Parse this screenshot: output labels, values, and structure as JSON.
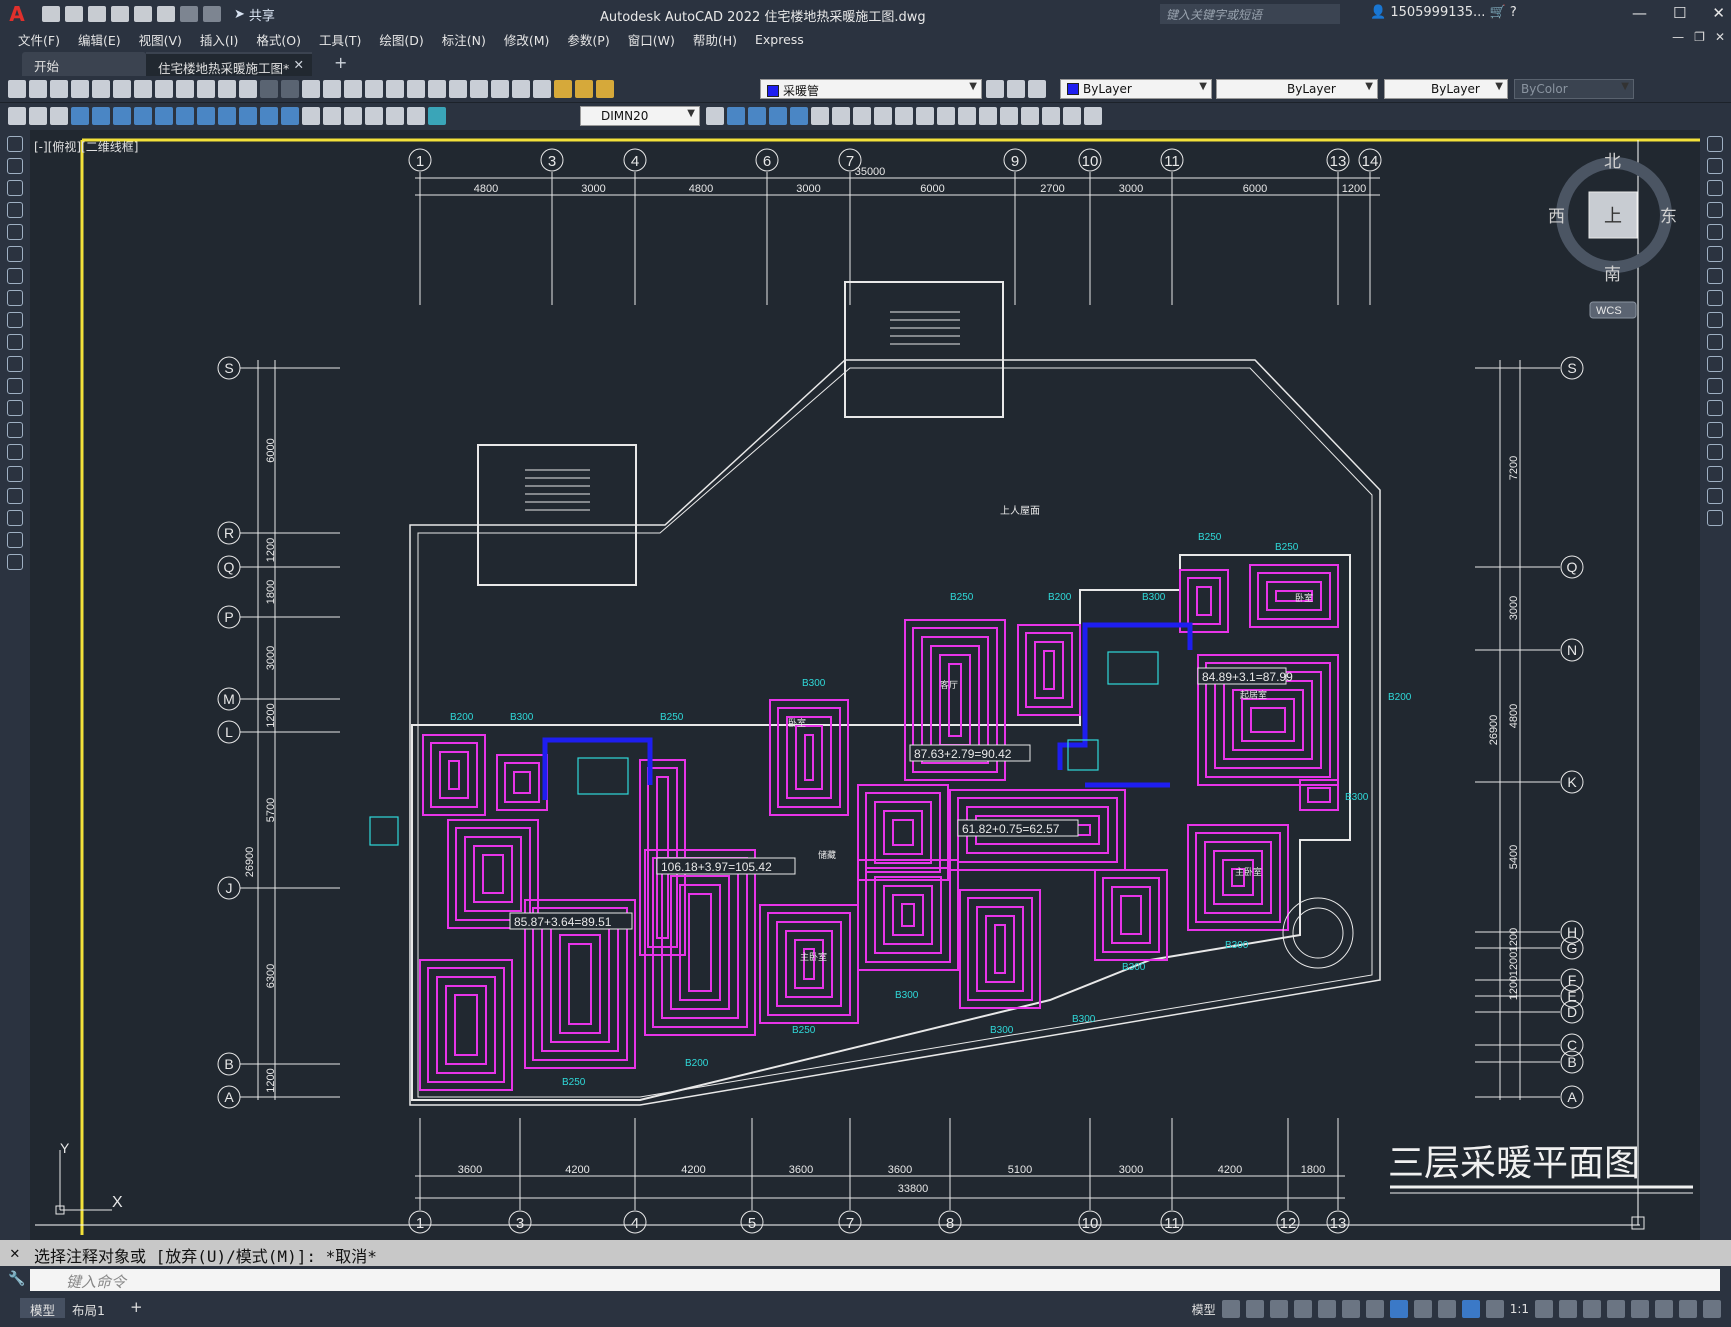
{
  "titlebar": {
    "app_title": "Autodesk AutoCAD 2022    住宅楼地热采暖施工图.dwg",
    "share_label": "共享",
    "search_placeholder": "键入关键字或短语",
    "user": "1505999135...",
    "logo": "A",
    "window_controls": [
      "—",
      "☐",
      "✕"
    ]
  },
  "menubar": {
    "items": [
      "文件(F)",
      "编辑(E)",
      "视图(V)",
      "插入(I)",
      "格式(O)",
      "工具(T)",
      "绘图(D)",
      "标注(N)",
      "修改(M)",
      "参数(P)",
      "窗口(W)",
      "帮助(H)",
      "Express"
    ]
  },
  "tabs": {
    "start": "开始",
    "drawing": "住宅楼地热采暖施工图*",
    "close": "✕",
    "add": "+"
  },
  "toolbar": {
    "layer": "采暖管",
    "layer_color": "#1e1ef0",
    "color": "ByLayer",
    "linetype": "ByLayer",
    "lineweight": "ByLayer",
    "plotstyle": "ByColor",
    "dimstyle": "DIMN20"
  },
  "viewport": {
    "label": "[-][俯视][二维线框]",
    "viewcube": {
      "north": "北",
      "south": "南",
      "east": "东",
      "west": "西",
      "top": "上",
      "wcs": "WCS"
    },
    "ucs": {
      "x": "X",
      "y": "Y"
    }
  },
  "drawing": {
    "title": "三层采暖平面图",
    "roof_label": "上人屋面",
    "top_axes": [
      "1",
      "3",
      "4",
      "6",
      "7",
      "9",
      "10",
      "11",
      "13",
      "14"
    ],
    "top_dims": [
      "4800",
      "3000",
      "4800",
      "3000",
      "6000",
      "2700",
      "3000",
      "6000",
      "1200"
    ],
    "top_total": "35000",
    "bottom_axes": [
      "1",
      "3",
      "4",
      "5",
      "7",
      "8",
      "10",
      "11",
      "12",
      "13"
    ],
    "bottom_dims": [
      "3600",
      "4200",
      "4200",
      "3600",
      "3600",
      "5100",
      "3000",
      "4200",
      "1800"
    ],
    "bottom_total": "33800",
    "left_axes": [
      "S",
      "R",
      "Q",
      "P",
      "M",
      "L",
      "J",
      "B",
      "A"
    ],
    "left_dims": [
      "6000",
      "1200",
      "1800",
      "3000",
      "1200",
      "5700",
      "6300",
      "1200"
    ],
    "left_total": "26900",
    "right_axes": [
      "S",
      "Q",
      "N",
      "K",
      "H",
      "G",
      "F",
      "E",
      "D",
      "C",
      "B",
      "A"
    ],
    "right_dims": [
      "7200",
      "3000",
      "4800",
      "5400",
      "1200",
      "1200",
      "1200"
    ],
    "right_total": "26900",
    "loop_tags": [
      "B200",
      "B300",
      "B250",
      "B300",
      "B250",
      "B200",
      "B300",
      "B250",
      "B250",
      "B300",
      "B300",
      "B300",
      "B300",
      "B300",
      "B250",
      "B200",
      "B250",
      "B200",
      "B300"
    ],
    "area_labels": [
      "84.89+3.1=87.99",
      "87.63+2.79=90.42",
      "106.18+3.97=105.42",
      "61.82+0.75=62.57",
      "85.87+3.64=89.51"
    ],
    "room_labels": [
      "卧室",
      "主卧室",
      "客厅",
      "起居室",
      "储藏",
      "卧室",
      "主卧室"
    ]
  },
  "command": {
    "history": "选择注释对象或 [放弃(U)/模式(M)]: *取消*",
    "placeholder": "键入命令"
  },
  "statusbar": {
    "model_tab": "模型",
    "layout_tab": "布局1",
    "add": "+",
    "model_label": "模型",
    "scale": "1:1"
  }
}
